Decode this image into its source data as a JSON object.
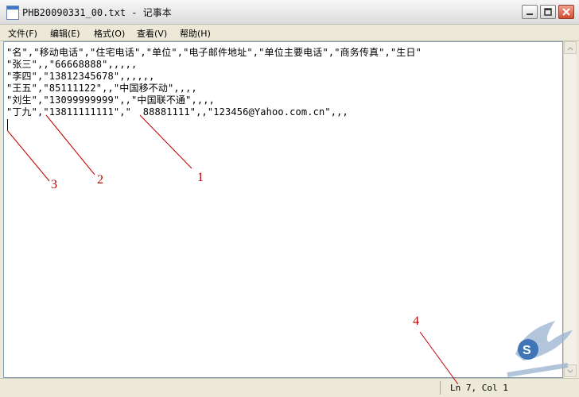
{
  "window": {
    "title": "PHB20090331_00.txt - 记事本"
  },
  "menu": [
    "文件(F)",
    "编辑(E)",
    "格式(O)",
    "查看(V)",
    "帮助(H)"
  ],
  "editor": {
    "lines": [
      "\"名\",\"移动电话\",\"住宅电话\",\"单位\",\"电子邮件地址\",\"单位主要电话\",\"商务传真\",\"生日\"",
      "\"张三\",,\"66668888\",,,,,",
      "\"李四\",\"13812345678\",,,,,,",
      "\"王五\",\"85111122\",,\"中国移不动\",,,,",
      "\"刘生\",\"13099999999\",,\"中国联不通\",,,,",
      "\"丁九\",\"13811111111\",\"  88881111\",,\"123456@Yahoo.com.cn\",,,"
    ]
  },
  "status": {
    "position": "Ln 7, Col 1"
  },
  "annotations": [
    "1",
    "2",
    "3",
    "4"
  ],
  "colors": {
    "annotation": "#c00000",
    "titlebar": "#dcdcdc",
    "menubar": "#ece9d8"
  },
  "icons": [
    "notepad-icon",
    "minimize-icon",
    "maximize-icon",
    "close-icon",
    "scroll-up-icon",
    "scroll-down-icon",
    "watermark-logo"
  ]
}
